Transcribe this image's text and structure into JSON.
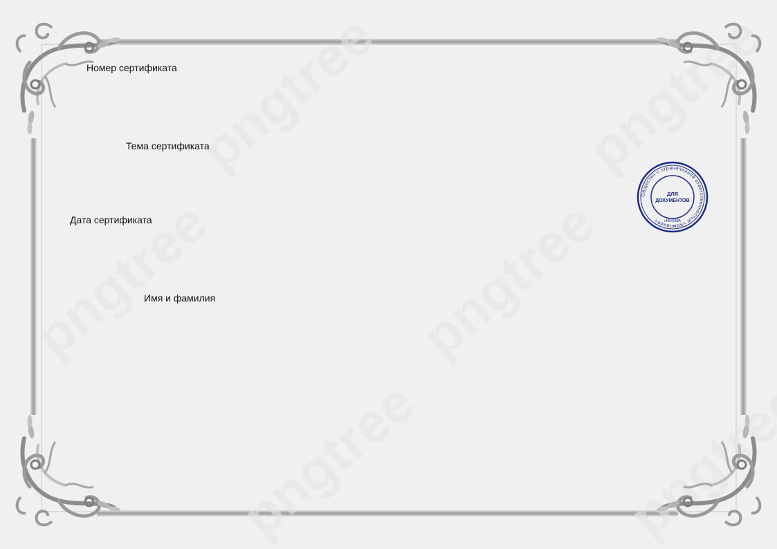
{
  "certificate": {
    "fields": {
      "number_label": "Номер сертификата",
      "topic_label": "Тема сертификата",
      "date_label": "Дата сертификата",
      "name_label": "Имя и фамилия"
    },
    "stamp": {
      "center_text_line1": "ДЛЯ",
      "center_text_line2": "ДОКУМЕНТОВ",
      "ring_text": "Общество с ограниченной ответственностью «Компания»",
      "city_text": "г.МОСКВА",
      "color": "#1a2a8a"
    },
    "watermark": {
      "text": "pngtree"
    },
    "frame": {
      "color": "#a8a8a8",
      "ornament_color": "#8c8c8c"
    }
  }
}
